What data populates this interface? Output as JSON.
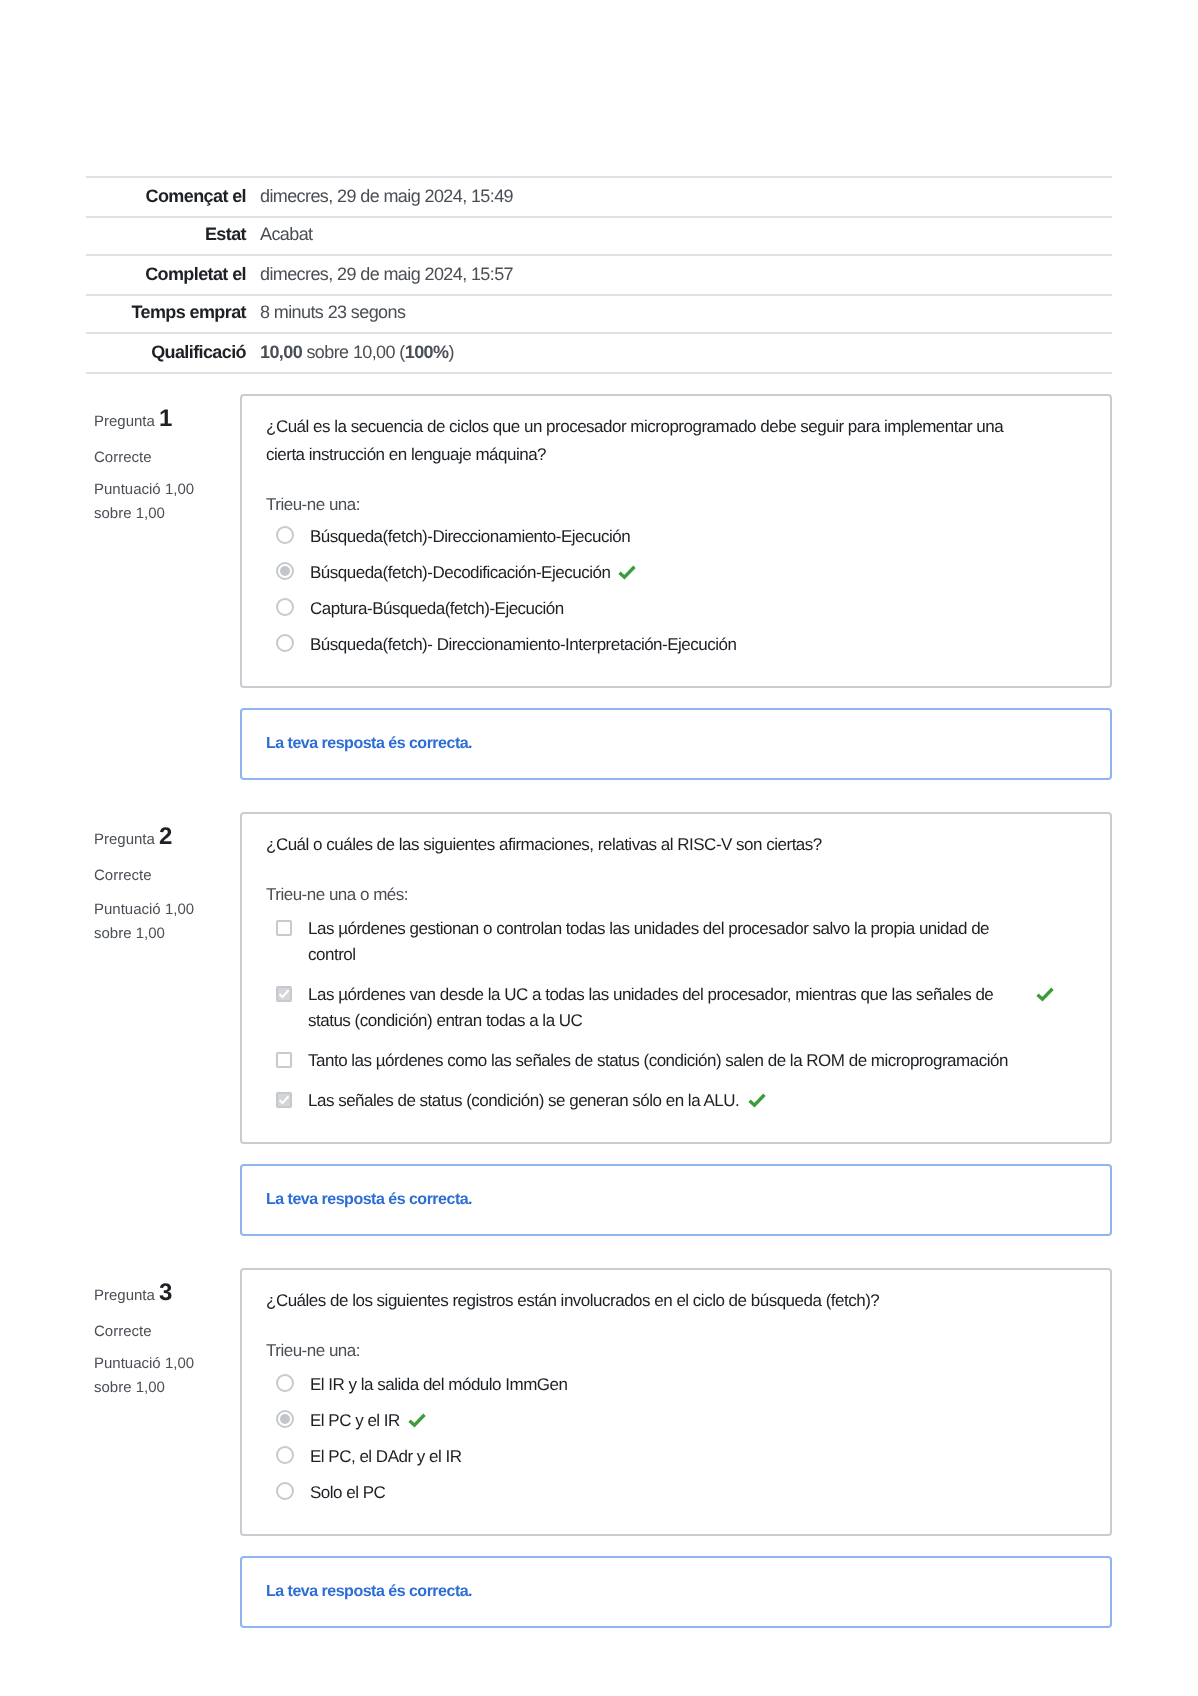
{
  "summary": [
    {
      "label": "Començat el",
      "value": "dimecres, 29 de maig 2024, 15:49"
    },
    {
      "label": "Estat",
      "value": "Acabat"
    },
    {
      "label": "Completat el",
      "value": "dimecres, 29 de maig 2024, 15:57"
    },
    {
      "label": "Temps emprat",
      "value": "8 minuts 23 segons"
    },
    {
      "label": "Qualificació",
      "value": "**10,00** sobre 10,00 (**100%**)"
    }
  ],
  "questions": [
    {
      "label": "Pregunta",
      "number": "1",
      "state": "Correcte",
      "score": "Puntuació 1,00 sobre 1,00",
      "kind": "radio",
      "text": "¿Cuál es la secuencia de ciclos que un procesador microprogramado debe seguir para implementar una cierta instrucción en lenguaje máquina?",
      "prompt": "Trieu-ne una:",
      "options": [
        {
          "text": "Búsqueda(fetch)-Direccionamiento-Ejecución",
          "selected": false,
          "correct": false
        },
        {
          "text": "Búsqueda(fetch)-Decodificación-Ejecución",
          "selected": true,
          "correct": true
        },
        {
          "text": "Captura-Búsqueda(fetch)-Ejecución",
          "selected": false,
          "correct": false
        },
        {
          "text": "Búsqueda(fetch)- Direccionamiento-Interpretación-Ejecución",
          "selected": false,
          "correct": false
        }
      ],
      "feedback": "La teva resposta és correcta."
    },
    {
      "label": "Pregunta",
      "number": "2",
      "state": "Correcte",
      "score": "Puntuació 1,00 sobre 1,00",
      "kind": "checkbox",
      "text": "¿Cuál o cuáles de las siguientes afirmaciones, relativas al RISC-V son ciertas?",
      "prompt": "Trieu-ne una o més:",
      "options": [
        {
          "text": "Las µórdenes gestionan o controlan todas las unidades del procesador salvo la propia unidad de control",
          "selected": false,
          "correct": false
        },
        {
          "text": "Las µórdenes van desde la UC a todas las unidades del procesador, mientras que las señales de status (condición) entran todas a la UC",
          "selected": true,
          "correct": true
        },
        {
          "text": "Tanto las µórdenes como las señales de status (condición) salen de la ROM de microprogramación",
          "selected": false,
          "correct": false
        },
        {
          "text": "Las señales de status (condición) se generan sólo en la ALU.",
          "selected": true,
          "correct": true
        }
      ],
      "feedback": "La teva resposta és correcta."
    },
    {
      "label": "Pregunta",
      "number": "3",
      "state": "Correcte",
      "score": "Puntuació 1,00 sobre 1,00",
      "kind": "radio",
      "text": "¿Cuáles de los siguientes registros están involucrados en el ciclo de búsqueda (fetch)?",
      "prompt": "Trieu-ne una:",
      "options": [
        {
          "text": "El IR y la salida del módulo ImmGen",
          "selected": false,
          "correct": false
        },
        {
          "text": "El PC y el IR",
          "selected": true,
          "correct": true
        },
        {
          "text": "El PC, el DAdr y el IR",
          "selected": false,
          "correct": false
        },
        {
          "text": "Solo el PC",
          "selected": false,
          "correct": false
        }
      ],
      "feedback": "La teva resposta és correcta."
    }
  ]
}
